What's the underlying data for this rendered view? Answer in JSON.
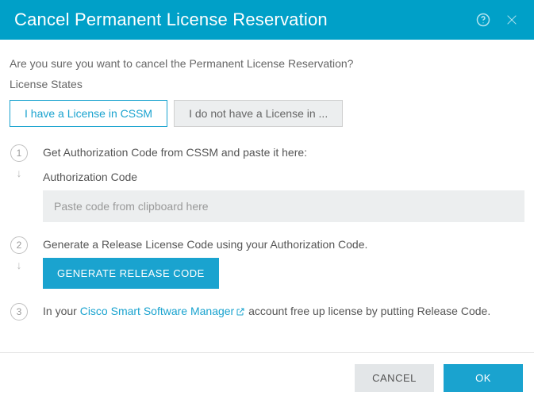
{
  "header": {
    "title": "Cancel Permanent License Reservation"
  },
  "confirm_text": "Are you sure you want to cancel the Permanent License Reservation?",
  "section_label": "License States",
  "tabs": {
    "active": "I have a License in CSSM",
    "inactive": "I do not have a License in ..."
  },
  "steps": {
    "s1": {
      "num": "1",
      "text": "Get Authorization Code from CSSM and paste it here:",
      "field_label": "Authorization Code",
      "placeholder": "Paste code from clipboard here"
    },
    "s2": {
      "num": "2",
      "text": "Generate a Release License Code using your Authorization Code.",
      "button": "GENERATE RELEASE CODE"
    },
    "s3": {
      "num": "3",
      "prefix": "In your ",
      "link": "Cisco Smart Software Manager",
      "suffix": " account free up license by putting Release Code."
    }
  },
  "footer": {
    "cancel": "CANCEL",
    "ok": "OK"
  }
}
